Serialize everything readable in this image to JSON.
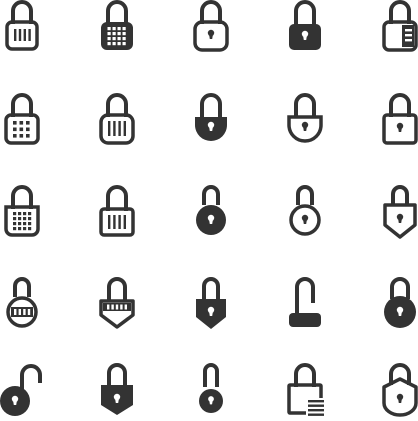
{
  "icons": [
    {
      "name": "combination-lock-icon",
      "kind": "combo"
    },
    {
      "name": "keypad-lock-icon",
      "kind": "keypad-solid"
    },
    {
      "name": "padlock-keyhole-outline-icon",
      "kind": "keyhole-outline"
    },
    {
      "name": "padlock-keyhole-solid-icon",
      "kind": "keyhole-solid"
    },
    {
      "name": "padlock-side-dial-icon",
      "kind": "side-dial"
    },
    {
      "name": "keypad-padlock-outline-icon",
      "kind": "keypad-outline"
    },
    {
      "name": "combination-padlock-outline-icon",
      "kind": "combo-outline"
    },
    {
      "name": "half-round-padlock-solid-icon",
      "kind": "half-round-solid"
    },
    {
      "name": "half-round-padlock-outline-icon",
      "kind": "half-round-outline"
    },
    {
      "name": "square-padlock-outline-icon",
      "kind": "square-outline"
    },
    {
      "name": "tall-keypad-lock-icon",
      "kind": "tall-keypad"
    },
    {
      "name": "tall-combination-lock-icon",
      "kind": "tall-combo"
    },
    {
      "name": "round-padlock-solid-icon",
      "kind": "round-solid"
    },
    {
      "name": "round-padlock-outline-icon",
      "kind": "round-outline"
    },
    {
      "name": "shield-padlock-outline-icon",
      "kind": "shield-outline"
    },
    {
      "name": "round-combination-lock-icon",
      "kind": "round-combo"
    },
    {
      "name": "shield-combination-lock-icon",
      "kind": "shield-combo"
    },
    {
      "name": "shield-padlock-solid-icon",
      "kind": "shield-solid"
    },
    {
      "name": "flat-padlock-icon",
      "kind": "flat"
    },
    {
      "name": "round-padlock-large-solid-icon",
      "kind": "round-big-solid"
    },
    {
      "name": "open-round-padlock-icon",
      "kind": "open-round"
    },
    {
      "name": "shield-padlock-solid-alt-icon",
      "kind": "shield-solid-2"
    },
    {
      "name": "small-round-padlock-icon",
      "kind": "small-round"
    },
    {
      "name": "padlock-with-lines-icon",
      "kind": "lines"
    },
    {
      "name": "padlock-shield-outline-icon",
      "kind": "shield-body-outline"
    }
  ],
  "colors": {
    "icon": "#333333",
    "background": "#ffffff"
  }
}
